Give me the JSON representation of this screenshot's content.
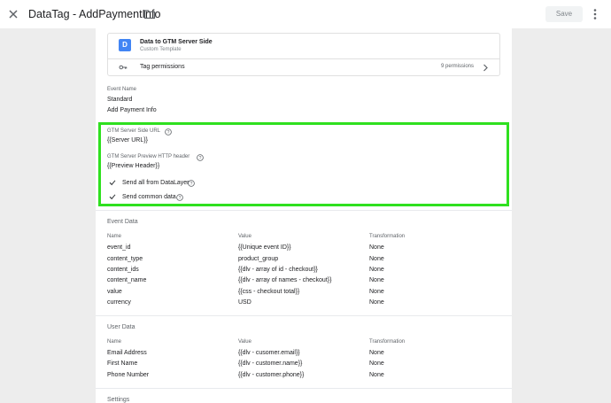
{
  "header": {
    "title": "DataTag - AddPaymentInfo",
    "save_label": "Save"
  },
  "template": {
    "icon_letter": "D",
    "name": "Data to GTM Server Side",
    "subtitle": "Custom Template",
    "permissions_label": "Tag permissions",
    "permissions_count": "9 permissions"
  },
  "event_name": {
    "label": "Event Name",
    "type": "Standard",
    "value": "Add Payment Info"
  },
  "gtm": {
    "url_label": "GTM Server Side URL",
    "url_value": "{{Server URL}}",
    "preview_label": "GTM Server Preview HTTP header",
    "preview_value": "{{Preview Header}}",
    "send_all_label": "Send all from DataLayer",
    "send_common_label": "Send common data"
  },
  "event_data": {
    "title": "Event Data",
    "columns": [
      "Name",
      "Value",
      "Transformation"
    ],
    "rows": [
      {
        "name": "event_id",
        "value": "{{Unique event ID}}",
        "transform": "None"
      },
      {
        "name": "content_type",
        "value": "product_group",
        "transform": "None"
      },
      {
        "name": "content_ids",
        "value": "{{dlv - array of id - checkout}}",
        "transform": "None"
      },
      {
        "name": "content_name",
        "value": "{{dlv - array of names - checkout}}",
        "transform": "None"
      },
      {
        "name": "value",
        "value": "{{css - checkout total}}",
        "transform": "None"
      },
      {
        "name": "currency",
        "value": "USD",
        "transform": "None"
      }
    ]
  },
  "user_data": {
    "title": "User Data",
    "columns": [
      "Name",
      "Value",
      "Transformation"
    ],
    "rows": [
      {
        "name": "Email Address",
        "value": "{{dlv - cusomer.email}}",
        "transform": "None"
      },
      {
        "name": "First Name",
        "value": "{{dlv - customer.name}}",
        "transform": "None"
      },
      {
        "name": "Phone Number",
        "value": "{{dlv - customer.phone}}",
        "transform": "None"
      }
    ]
  },
  "settings": {
    "title": "Settings"
  },
  "colors": {
    "highlight": "#2fe01f",
    "template_icon": "#4285f4"
  }
}
